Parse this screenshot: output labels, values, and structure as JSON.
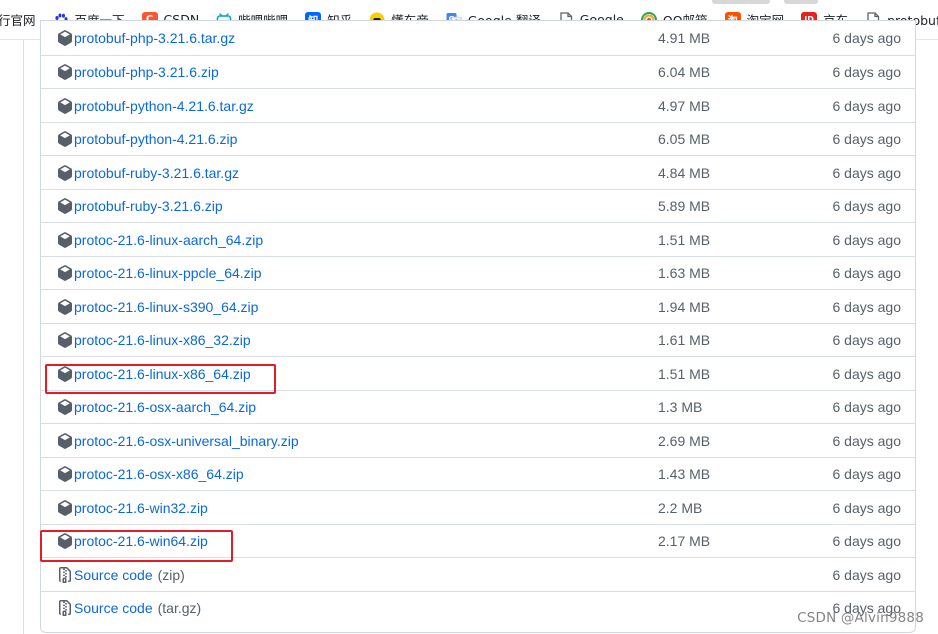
{
  "bookmarks": [
    {
      "label": "行官网",
      "icon": "none",
      "color": ""
    },
    {
      "label": "百度一下",
      "icon": "baidu-paw-icon",
      "color": "#2932e1"
    },
    {
      "label": "CSDN",
      "icon": "csdn-logo-icon",
      "color": "#fc5531"
    },
    {
      "label": "哔哩哔哩",
      "icon": "bilibili-tv-icon",
      "color": "#00a1d6"
    },
    {
      "label": "知乎",
      "icon": "zhihu-logo-icon",
      "color": "#0066ff"
    },
    {
      "label": "懂车帝",
      "icon": "dongchedi-logo-icon",
      "color": "#ffcc00"
    },
    {
      "label": "Google 翻译",
      "icon": "google-translate-icon",
      "color": "#4285f4"
    },
    {
      "label": "Google",
      "icon": "page-icon",
      "color": "#5f6368"
    },
    {
      "label": "QQ邮箱",
      "icon": "qq-mail-icon",
      "color": "#f5a623"
    },
    {
      "label": "淘宝网",
      "icon": "taobao-logo-icon",
      "color": "#ff5000"
    },
    {
      "label": "京东",
      "icon": "jd-logo-icon",
      "color": "#e1251b"
    },
    {
      "label": "protobuf优缺",
      "icon": "page-icon",
      "color": "#5f6368"
    }
  ],
  "bookmark_glyphs": {
    "csdn": "C",
    "zhihu": "知",
    "jd": "JD",
    "taobao": "淘"
  },
  "assets": [
    {
      "name": "protobuf-php-3.21.6.tar.gz",
      "size": "4.91 MB",
      "date": "6 days ago",
      "icon": "package-icon"
    },
    {
      "name": "protobuf-php-3.21.6.zip",
      "size": "6.04 MB",
      "date": "6 days ago",
      "icon": "package-icon"
    },
    {
      "name": "protobuf-python-4.21.6.tar.gz",
      "size": "4.97 MB",
      "date": "6 days ago",
      "icon": "package-icon"
    },
    {
      "name": "protobuf-python-4.21.6.zip",
      "size": "6.05 MB",
      "date": "6 days ago",
      "icon": "package-icon"
    },
    {
      "name": "protobuf-ruby-3.21.6.tar.gz",
      "size": "4.84 MB",
      "date": "6 days ago",
      "icon": "package-icon"
    },
    {
      "name": "protobuf-ruby-3.21.6.zip",
      "size": "5.89 MB",
      "date": "6 days ago",
      "icon": "package-icon"
    },
    {
      "name": "protoc-21.6-linux-aarch_64.zip",
      "size": "1.51 MB",
      "date": "6 days ago",
      "icon": "package-icon"
    },
    {
      "name": "protoc-21.6-linux-ppcle_64.zip",
      "size": "1.63 MB",
      "date": "6 days ago",
      "icon": "package-icon"
    },
    {
      "name": "protoc-21.6-linux-s390_64.zip",
      "size": "1.94 MB",
      "date": "6 days ago",
      "icon": "package-icon"
    },
    {
      "name": "protoc-21.6-linux-x86_32.zip",
      "size": "1.61 MB",
      "date": "6 days ago",
      "icon": "package-icon"
    },
    {
      "name": "protoc-21.6-linux-x86_64.zip",
      "size": "1.51 MB",
      "date": "6 days ago",
      "icon": "package-icon",
      "highlighted": true
    },
    {
      "name": "protoc-21.6-osx-aarch_64.zip",
      "size": "1.3 MB",
      "date": "6 days ago",
      "icon": "package-icon"
    },
    {
      "name": "protoc-21.6-osx-universal_binary.zip",
      "size": "2.69 MB",
      "date": "6 days ago",
      "icon": "package-icon"
    },
    {
      "name": "protoc-21.6-osx-x86_64.zip",
      "size": "1.43 MB",
      "date": "6 days ago",
      "icon": "package-icon"
    },
    {
      "name": "protoc-21.6-win32.zip",
      "size": "2.2 MB",
      "date": "6 days ago",
      "icon": "package-icon"
    },
    {
      "name": "protoc-21.6-win64.zip",
      "size": "2.17 MB",
      "date": "6 days ago",
      "icon": "package-icon",
      "highlighted": true
    },
    {
      "name": "Source code",
      "suffix": "(zip)",
      "size": "",
      "date": "6 days ago",
      "icon": "file-zip-icon"
    },
    {
      "name": "Source code",
      "suffix": "(tar.gz)",
      "size": "",
      "date": "6 days ago",
      "icon": "file-zip-icon"
    }
  ],
  "colors": {
    "link": "#0969da",
    "muted": "#57606a",
    "border": "#d0d7de",
    "highlight": "#e11d2a"
  },
  "watermark": "CSDN @Alvin9888"
}
